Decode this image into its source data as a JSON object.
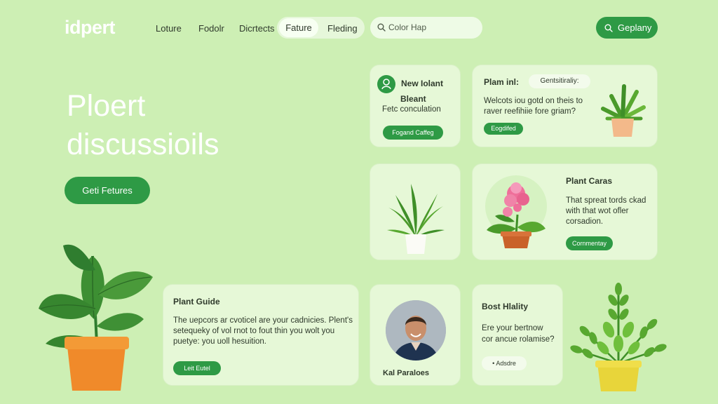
{
  "header": {
    "logo": "idpert",
    "nav": [
      "Loture",
      "Fodolr",
      "Dicrtects",
      "Fature",
      "Fleding"
    ],
    "active_nav": "Fature",
    "search": {
      "placeholder": "Color Hap"
    },
    "cta": "Geplany"
  },
  "hero": {
    "title_line1": "Ploert",
    "title_line2": "discussioils",
    "button": "Geti Fetures"
  },
  "cards": {
    "new_plant": {
      "title": "New Iolant",
      "subtitle": "Bleant",
      "text": "Fetc conculation",
      "button": "Fogand Caffeg"
    },
    "plant_info": {
      "title": "Plam inl:",
      "chip": "Gentsitiraliy:",
      "text_line1": "Welcots iou gotd on theis to",
      "text_line2": "raver reefihiie fore griam?",
      "button": "Eogdifed"
    },
    "plant_care": {
      "title": "Plant Caras",
      "text_line1": "That spreat tords ckad",
      "text_line2": "with that wot ofler",
      "text_line3": "corsadion.",
      "button": "Cornmentay"
    },
    "plant_guide": {
      "title": "Plant Guide",
      "text_line1": "The uepcors ar cvoticel are your cadnicies. Plent's",
      "text_line2": "setequeky of vol rnot to fout thin you wolt you",
      "text_line3": "puetye: you uoll hesuition.",
      "button": "Leit Eutel"
    },
    "profile": {
      "name": "Kal Paraloes"
    },
    "best_healthy": {
      "title": "Bost Hlality",
      "text_line1": "Ere your bertnow",
      "text_line2": "cor ancue rolamise?",
      "button": "Adsdre"
    }
  },
  "colors": {
    "background": "#cdefb4",
    "accent": "#2e9a45",
    "card": "#e6f8d7"
  },
  "icons": [
    "search-icon",
    "user-icon",
    "plant-icon",
    "flower-icon"
  ]
}
